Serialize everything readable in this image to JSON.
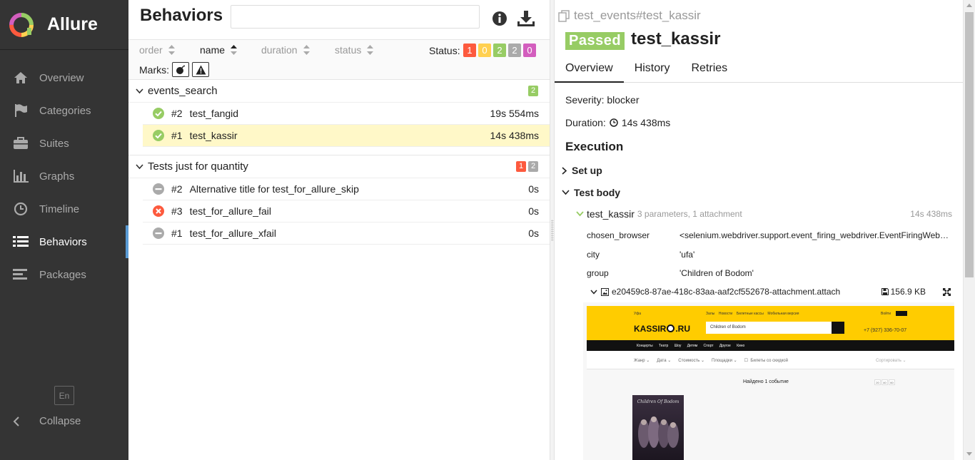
{
  "app": {
    "name": "Allure",
    "brand_colors": {
      "green": "#97cc64",
      "yellow": "#ffd050",
      "red": "#fd5a3e",
      "purple": "#d35ebe"
    }
  },
  "sidebar": {
    "items": [
      {
        "label": "Overview",
        "icon": "home-icon"
      },
      {
        "label": "Categories",
        "icon": "flag-icon"
      },
      {
        "label": "Suites",
        "icon": "briefcase-icon"
      },
      {
        "label": "Graphs",
        "icon": "bar-chart-icon"
      },
      {
        "label": "Timeline",
        "icon": "clock-icon"
      },
      {
        "label": "Behaviors",
        "icon": "list-icon",
        "active": true
      },
      {
        "label": "Packages",
        "icon": "align-left-icon"
      }
    ],
    "language": "En",
    "collapse_label": "Collapse"
  },
  "behaviors": {
    "title": "Behaviors",
    "search": {
      "value": "",
      "placeholder": ""
    },
    "sort": {
      "order": "order",
      "name": "name",
      "duration": "duration",
      "status": "status"
    },
    "status_label": "Status:",
    "status_counts": {
      "failed": "1",
      "broken": "0",
      "passed": "2",
      "skipped": "2",
      "unknown": "0"
    },
    "marks_label": "Marks:",
    "groups": [
      {
        "name": "events_search",
        "badges": [
          {
            "type": "passed",
            "count": "2"
          }
        ],
        "tests": [
          {
            "num": "#2",
            "name": "test_fangid",
            "duration": "19s 554ms",
            "status": "passed"
          },
          {
            "num": "#1",
            "name": "test_kassir",
            "duration": "14s 438ms",
            "status": "passed",
            "selected": true
          }
        ]
      },
      {
        "name": "Tests just for quantity",
        "badges": [
          {
            "type": "failed",
            "count": "1"
          },
          {
            "type": "skipped",
            "count": "2"
          }
        ],
        "tests": [
          {
            "num": "#2",
            "name": "Alternative title for test_for_allure_skip",
            "duration": "0s",
            "status": "skipped"
          },
          {
            "num": "#3",
            "name": "test_for_allure_fail",
            "duration": "0s",
            "status": "failed"
          },
          {
            "num": "#1",
            "name": "test_for_allure_xfail",
            "duration": "0s",
            "status": "skipped"
          }
        ]
      }
    ]
  },
  "detail": {
    "breadcrumb": "test_events#test_kassir",
    "status": "Passed",
    "title": "test_kassir",
    "tabs": [
      "Overview",
      "History",
      "Retries"
    ],
    "severity_label": "Severity:",
    "severity": "blocker",
    "duration_label": "Duration:",
    "duration": "14s 438ms",
    "execution_label": "Execution",
    "setup_label": "Set up",
    "body_label": "Test body",
    "step": {
      "name": "test_kassir",
      "meta": "3 parameters, 1 attachment",
      "duration": "14s 438ms"
    },
    "params": [
      {
        "key": "chosen_browser",
        "value": "<selenium.webdriver.support.event_firing_webdriver.EventFiringWebDriver object>"
      },
      {
        "key": "city",
        "value": "'ufa'"
      },
      {
        "key": "group",
        "value": "'Children of Bodom'"
      }
    ],
    "attachment": {
      "name": "e20459c8-87ae-418c-83aa-aaf2cf552678-attachment.attach",
      "size": "156.9 KB"
    },
    "screenshot": {
      "city": "Уфа",
      "top_links": "Залы    Новости    Билетные кассы    Мобильная версия",
      "login": "Войти",
      "logo": "KASSIR",
      "logo_suffix": ".RU",
      "search_value": "Children of Bodom",
      "phone": "+7 (927) 336-70-07",
      "nav": "Концерты      Театр      Шоу      Детям      Спорт      Другое      Кино",
      "filters": "Жанр ⌄      Дата ⌄      Стоимость ⌄      Площадки ⌄      ☐  Билеты со скидкой",
      "sort": "Сортировать ⌄",
      "found": "Найдено 1 событие",
      "poster_title": "Children Of Bodom",
      "pages": [
        "20",
        "40",
        "60"
      ]
    }
  }
}
